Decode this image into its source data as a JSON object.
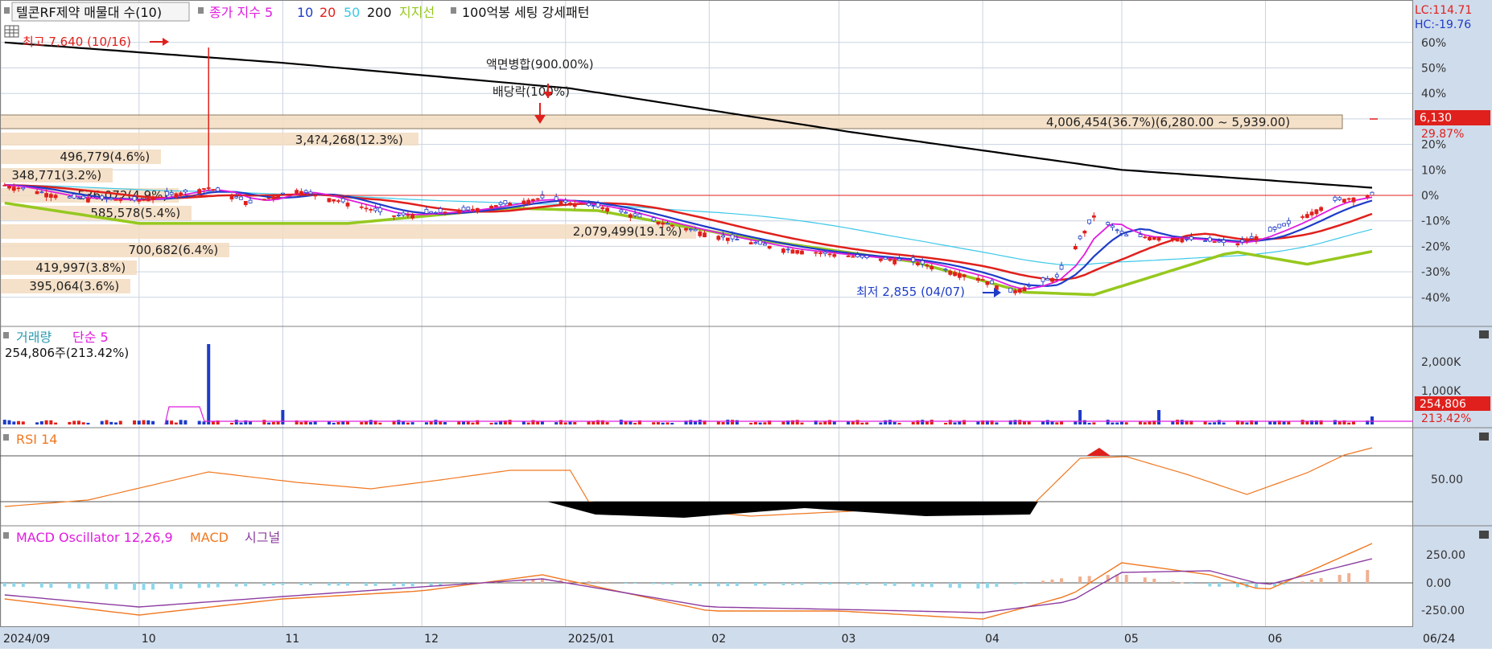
{
  "header": {
    "stock": "텔콘RF제약 매물대 수(10)",
    "price_label": "종가 지수 5",
    "ma10": "10",
    "ma20": "20",
    "ma50": "50",
    "ma200": "200",
    "support_label": "지지선",
    "pattern_label": "100억봉 세팅 강세패턴"
  },
  "right_top": {
    "lc": "LC:114.71",
    "hc": "HC:-19.76"
  },
  "price_axis": {
    "ticks": [
      "60%",
      "50%",
      "40%",
      "30%",
      "20%",
      "10%",
      "0%",
      "-10%",
      "-20%",
      "-30%",
      "-40%"
    ],
    "current_price": "6,130",
    "current_pct": "29.87%"
  },
  "annotations": {
    "high": "최고 7,640 (10/16)",
    "low": "최저 2,855 (04/07)",
    "split": "액면병합(900.00%)",
    "dividend": "배당락(100%)",
    "top_zone": "4,006,454(36.7%)(6,280.00 ~ 5,939.00)",
    "overlap": "3,4?4,268(12.3%)"
  },
  "volume_profile": [
    {
      "label": "4,006,454(36.7%)"
    },
    {
      "label": "3,4?4,268(12.3%)"
    },
    {
      "label": "496,779(4.6%)"
    },
    {
      "label": "348,771(3.2%)"
    },
    {
      "label": "536,072(4.9%)"
    },
    {
      "label": "585,578(5.4%)"
    },
    {
      "label": "2,079,499(19.1%)"
    },
    {
      "label": "700,682(6.4%)"
    },
    {
      "label": "419,997(3.8%)"
    },
    {
      "label": "395,064(3.6%)"
    }
  ],
  "volume_panel": {
    "title": "거래량",
    "ma_label": "단순 5",
    "current": "254,806주(213.42%)",
    "ticks": [
      "2,000K",
      "1,000K"
    ],
    "current_value": "254,806",
    "current_pct": "213.42%"
  },
  "rsi_panel": {
    "title": "RSI 14",
    "tick": "50.00"
  },
  "macd_panel": {
    "title": "MACD Oscillator 12,26,9",
    "macd": "MACD",
    "signal": "시그널",
    "ticks": [
      "250.00",
      "0.00",
      "-250.00"
    ]
  },
  "x_axis": {
    "labels": [
      "2024/09",
      "10",
      "11",
      "12",
      "2025/01",
      "02",
      "03",
      "04",
      "05",
      "06"
    ],
    "last_date": "06/24"
  },
  "colors": {
    "up": "#e0201c",
    "down": "#1e3cc8",
    "ma5": "#e01ce0",
    "ma10": "#1e3cc8",
    "ma20": "#e0201c",
    "ma50": "#3cc8e8",
    "ma200": "#000000",
    "support": "#96c81e",
    "rsi": "#f07820",
    "macd": "#f07820",
    "signal": "#8c3ca0"
  },
  "chart_data": {
    "type": "line",
    "title": "텔콘RF제약",
    "x_axis_type": "date",
    "x_range": [
      "2024-09-01",
      "2025-06-24"
    ],
    "y_axis_unit": "% (relative to 2025-06-24 reference price)",
    "ylim": [
      -45,
      63
    ],
    "series": [
      {
        "name": "종가",
        "points": [
          [
            "2024-09-02",
            4
          ],
          [
            "2024-09-16",
            -1
          ],
          [
            "2024-10-01",
            -2
          ],
          [
            "2024-10-16",
            3
          ],
          [
            "2024-10-25",
            -3
          ],
          [
            "2024-11-04",
            2
          ],
          [
            "2024-11-15",
            -3
          ],
          [
            "2024-11-25",
            -8
          ],
          [
            "2024-12-10",
            -6
          ],
          [
            "2024-12-27",
            -1
          ],
          [
            "2025-01-02",
            -3
          ],
          [
            "2025-01-10",
            -5
          ],
          [
            "2025-01-20",
            -10
          ],
          [
            "2025-02-03",
            -16
          ],
          [
            "2025-02-17",
            -21
          ],
          [
            "2025-03-04",
            -24
          ],
          [
            "2025-03-17",
            -26
          ],
          [
            "2025-04-01",
            -33
          ],
          [
            "2025-04-07",
            -38
          ],
          [
            "2025-04-17",
            -32
          ],
          [
            "2025-04-25",
            -8
          ],
          [
            "2025-05-02",
            -16
          ],
          [
            "2025-05-14",
            -17
          ],
          [
            "2025-05-26",
            -19
          ],
          [
            "2025-06-05",
            -12
          ],
          [
            "2025-06-16",
            -2
          ],
          [
            "2025-06-24",
            0
          ]
        ]
      },
      {
        "name": "200",
        "points": [
          [
            "2024-09-02",
            60
          ],
          [
            "2024-11-01",
            52
          ],
          [
            "2025-01-02",
            42
          ],
          [
            "2025-03-03",
            25
          ],
          [
            "2025-05-01",
            10
          ],
          [
            "2025-06-24",
            3
          ]
        ]
      },
      {
        "name": "지지선",
        "points": [
          [
            "2024-09-02",
            -3
          ],
          [
            "2024-10-01",
            -11
          ],
          [
            "2024-11-15",
            -11
          ],
          [
            "2024-12-20",
            -5
          ],
          [
            "2025-01-08",
            -6
          ],
          [
            "2025-02-10",
            -17
          ],
          [
            "2025-03-17",
            -26
          ],
          [
            "2025-04-10",
            -38
          ],
          [
            "2025-04-25",
            -39
          ],
          [
            "2025-05-25",
            -22
          ],
          [
            "2025-06-10",
            -27
          ],
          [
            "2025-06-24",
            -22
          ]
        ]
      }
    ],
    "annotations": [
      {
        "x": "2024-10-16",
        "label": "최고 7,640 (10/16)"
      },
      {
        "x": "2025-04-07",
        "label": "최저 2,855 (04/07)"
      },
      {
        "x": "2025-01-02",
        "label": "액면병합(900.00%)"
      },
      {
        "x": "2025-01-02",
        "label": "배당락(100%)"
      }
    ]
  }
}
